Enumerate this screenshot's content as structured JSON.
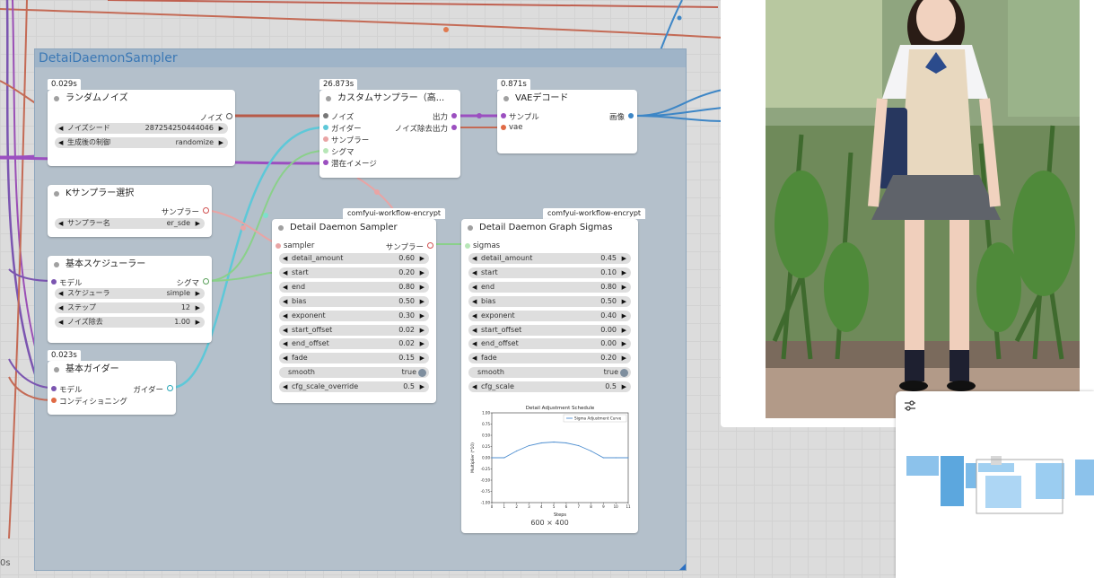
{
  "group": {
    "title": "DetaiDaemonSampler"
  },
  "nodes": {
    "random_noise": {
      "time": "0.029s",
      "title": "ランダムノイズ",
      "output": "ノイズ",
      "noise_seed": {
        "label": "ノイズシード",
        "value": "287254250444046"
      },
      "control_after": {
        "label": "生成後の制御",
        "value": "randomize"
      }
    },
    "ksampler_select": {
      "title": "Kサンプラー選択",
      "output": "サンプラー",
      "sampler_name": {
        "label": "サンプラー名",
        "value": "er_sde"
      }
    },
    "basic_scheduler": {
      "title": "基本スケジューラー",
      "input": "モデル",
      "output": "シグマ",
      "scheduler": {
        "label": "スケジューラ",
        "value": "simple"
      },
      "steps": {
        "label": "ステップ",
        "value": "12"
      },
      "denoise": {
        "label": "ノイズ除去",
        "value": "1.00"
      }
    },
    "basic_guider": {
      "time": "0.023s",
      "title": "基本ガイダー",
      "inputs": [
        "モデル",
        "コンディショニング"
      ],
      "output": "ガイダー"
    },
    "custom_sampler": {
      "time": "26.873s",
      "title": "カスタムサンプラー（高...",
      "inputs": [
        "ノイズ",
        "ガイダー",
        "サンプラー",
        "シグマ",
        "潜在イメージ"
      ],
      "outputs": [
        "出力",
        "ノイズ除去出力"
      ]
    },
    "vae_decode": {
      "time": "0.871s",
      "title": "VAEデコード",
      "inputs": [
        "サンプル",
        "vae"
      ],
      "output": "画像"
    },
    "detail_daemon_sampler": {
      "badge": "comfyui-workflow-encrypt",
      "title": "Detail Daemon Sampler",
      "input": "sampler",
      "output": "サンプラー",
      "widgets": [
        {
          "label": "detail_amount",
          "value": "0.60"
        },
        {
          "label": "start",
          "value": "0.20"
        },
        {
          "label": "end",
          "value": "0.80"
        },
        {
          "label": "bias",
          "value": "0.50"
        },
        {
          "label": "exponent",
          "value": "0.30"
        },
        {
          "label": "start_offset",
          "value": "0.02"
        },
        {
          "label": "end_offset",
          "value": "0.02"
        },
        {
          "label": "fade",
          "value": "0.15"
        },
        {
          "label": "smooth",
          "value": "true"
        },
        {
          "label": "cfg_scale_override",
          "value": "0.5"
        }
      ]
    },
    "detail_daemon_graph": {
      "badge": "comfyui-workflow-encrypt",
      "title": "Detail Daemon Graph Sigmas",
      "input": "sigmas",
      "widgets": [
        {
          "label": "detail_amount",
          "value": "0.45"
        },
        {
          "label": "start",
          "value": "0.10"
        },
        {
          "label": "end",
          "value": "0.80"
        },
        {
          "label": "bias",
          "value": "0.50"
        },
        {
          "label": "exponent",
          "value": "0.40"
        },
        {
          "label": "start_offset",
          "value": "0.00"
        },
        {
          "label": "end_offset",
          "value": "0.00"
        },
        {
          "label": "fade",
          "value": "0.20"
        },
        {
          "label": "smooth",
          "value": "true"
        },
        {
          "label": "cfg_scale",
          "value": "0.5"
        }
      ],
      "image_size": "600 × 400"
    }
  },
  "chart_data": {
    "type": "line",
    "title": "Detail Adjustment Schedule",
    "xlabel": "Steps",
    "ylabel": "Multiplier (*10)",
    "x": [
      0,
      1,
      2,
      3,
      4,
      5,
      6,
      7,
      8,
      9,
      10,
      11
    ],
    "series": [
      {
        "name": "Sigma Adjustment Curve",
        "values": [
          0,
          0,
          0.15,
          0.27,
          0.33,
          0.35,
          0.33,
          0.27,
          0.15,
          0,
          0,
          0
        ]
      }
    ],
    "xlim": [
      0,
      11
    ],
    "ylim": [
      -1.0,
      1.0
    ],
    "yticks": [
      "1.00",
      "0.75",
      "0.50",
      "0.25",
      "0.00",
      "-0.25",
      "-0.50",
      "-0.75",
      "-1.00"
    ],
    "xticks": [
      "0",
      "1",
      "2",
      "3",
      "4",
      "5",
      "6",
      "7",
      "8",
      "9",
      "10",
      "11"
    ],
    "legend": "top-right",
    "color": "#4f8fd0"
  },
  "side_text": "0s",
  "colors": {
    "noise_wire": "#b85a48",
    "guider_wire": "#5ec8d8",
    "latent_wire": "#9b4fc0",
    "image_wire": "#3d86c6",
    "sigma_wire": "#8ad08a",
    "sampler_wire": "#e9a4a4"
  },
  "minimap": {
    "icon": "settings-sliders-icon"
  }
}
